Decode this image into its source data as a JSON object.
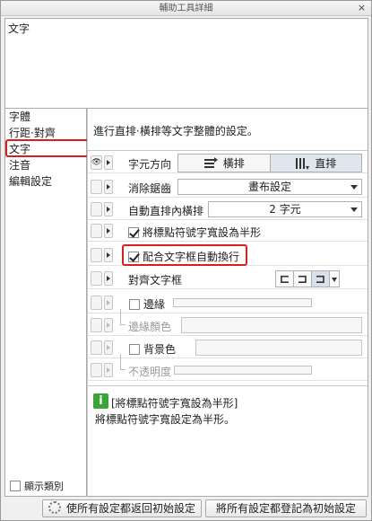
{
  "window": {
    "title": "輔助工具詳細",
    "close_symbol": "×"
  },
  "preview": {
    "text": "文字"
  },
  "categories": {
    "items": [
      {
        "label": "字體"
      },
      {
        "label": "行距·對齊"
      },
      {
        "label": "文字"
      },
      {
        "label": "注音"
      },
      {
        "label": "編輯設定"
      }
    ],
    "selected_index": 2
  },
  "show_class": {
    "label": "顯示類別",
    "checked": false
  },
  "settings": {
    "description": "進行直排·橫排等文字整體的設定。",
    "char_direction": {
      "label": "字元方向",
      "options": [
        "橫排",
        "直排"
      ],
      "selected": "直排"
    },
    "antialiasing": {
      "label": "消除鋸齒",
      "value": "畫布設定"
    },
    "auto_tate_chu_yoko": {
      "label": "自動直排內橫排",
      "value": "2 字元"
    },
    "half_width_punct": {
      "label": "將標點符號字寬設為半形",
      "checked": true
    },
    "auto_wrap": {
      "label": "配合文字框自動換行",
      "checked": true
    },
    "align_frame": {
      "label": "對齊文字框"
    },
    "border": {
      "label": "邊緣",
      "color_label": "邊緣顏色",
      "checked": false
    },
    "background": {
      "label": "背景色",
      "opacity_label": "不透明度",
      "checked": false
    }
  },
  "info": {
    "icon": "i",
    "title": "[將標點符號字寬設為半形]",
    "body": "將標點符號字寬設定為半形。"
  },
  "bottom": {
    "reset_label": "使所有設定都返回初始設定",
    "register_label": "將所有設定都登記為初始設定"
  },
  "colors": {
    "highlight": "#d62020",
    "info_green": "#3aa33a"
  }
}
